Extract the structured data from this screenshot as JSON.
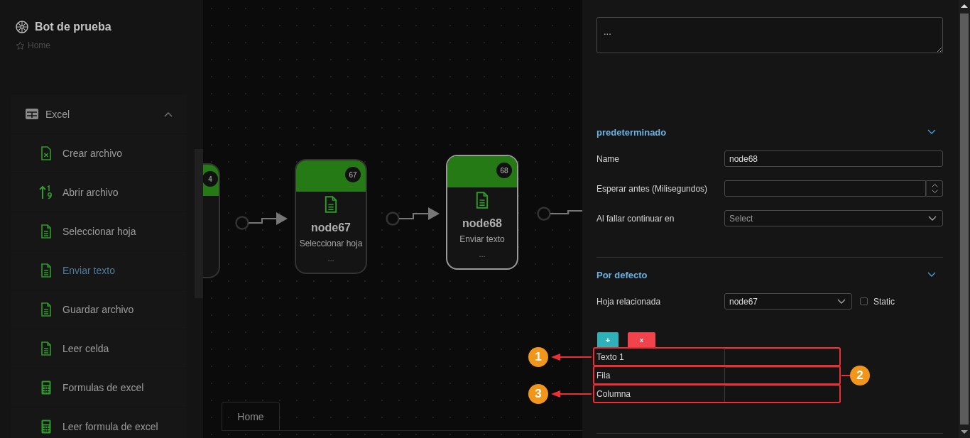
{
  "sidebar": {
    "title": "Bot de prueba",
    "breadcrumb": "Home",
    "group": {
      "label": "Excel",
      "expanded": true,
      "items": [
        {
          "label": "Crear archivo",
          "kind": "spreadsheet",
          "selected": false
        },
        {
          "label": "Abrir archivo",
          "kind": "sort",
          "selected": false
        },
        {
          "label": "Seleccionar hoja",
          "kind": "document",
          "selected": false
        },
        {
          "label": "Enviar texto",
          "kind": "document",
          "selected": true
        },
        {
          "label": "Guardar archivo",
          "kind": "document",
          "selected": false
        },
        {
          "label": "Leer celda",
          "kind": "document",
          "selected": false
        },
        {
          "label": "Formulas de excel",
          "kind": "calculator",
          "selected": false
        },
        {
          "label": "Leer formula de excel",
          "kind": "calculator",
          "selected": false
        }
      ]
    }
  },
  "canvas": {
    "nodes": [
      {
        "badge": "4",
        "selected": false
      },
      {
        "badge": "67",
        "name": "node67",
        "action": "Seleccionar hoja",
        "more": "...",
        "selected": false
      },
      {
        "badge": "68",
        "name": "node68",
        "action": "Enviar texto",
        "more": "...",
        "selected": true
      }
    ],
    "tabs": [
      {
        "label": "Home"
      }
    ]
  },
  "panel": {
    "description": {
      "placeholder": "..."
    },
    "sections": [
      {
        "title": "predeterminado",
        "expanded": true,
        "fields": [
          {
            "kind": "text",
            "label": "Name",
            "value": "node68"
          },
          {
            "kind": "number",
            "label": "Esperar antes (Milisegundos)"
          },
          {
            "kind": "select",
            "label": "Al fallar continuar en",
            "placeholder": "Select"
          }
        ]
      },
      {
        "title": "Por defecto",
        "expanded": true,
        "fields": [
          {
            "kind": "select",
            "label": "Hoja relacionada",
            "value": "node67",
            "static": {
              "label": "Static",
              "checked": false
            }
          }
        ],
        "add_button": "+",
        "remove_button": "x",
        "params": [
          {
            "label": "Texto 1",
            "callout": "1",
            "callout_on_right": false
          },
          {
            "label": "Fila",
            "callout": "2",
            "callout_on_right": true
          },
          {
            "label": "Columna",
            "callout": "3",
            "callout_on_right": false
          }
        ]
      }
    ]
  }
}
